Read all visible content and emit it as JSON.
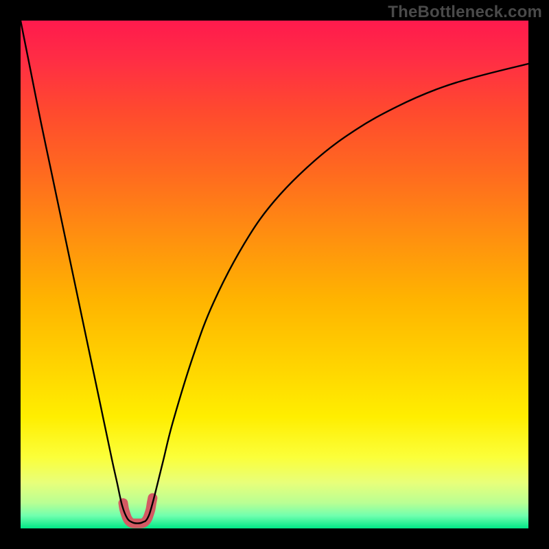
{
  "watermark": "TheBottleneck.com",
  "gradient": {
    "stops": [
      {
        "offset": 0.0,
        "color": "#ff1a4d"
      },
      {
        "offset": 0.08,
        "color": "#ff2e44"
      },
      {
        "offset": 0.18,
        "color": "#ff4a2e"
      },
      {
        "offset": 0.3,
        "color": "#ff6a1f"
      },
      {
        "offset": 0.42,
        "color": "#ff8e10"
      },
      {
        "offset": 0.55,
        "color": "#ffb400"
      },
      {
        "offset": 0.68,
        "color": "#ffd400"
      },
      {
        "offset": 0.78,
        "color": "#ffee00"
      },
      {
        "offset": 0.86,
        "color": "#fbff3a"
      },
      {
        "offset": 0.91,
        "color": "#e8ff7a"
      },
      {
        "offset": 0.95,
        "color": "#b9ff94"
      },
      {
        "offset": 0.975,
        "color": "#70ffae"
      },
      {
        "offset": 1.0,
        "color": "#00e887"
      }
    ]
  },
  "chart_data": {
    "type": "line",
    "title": "",
    "xlabel": "",
    "ylabel": "",
    "xlim": [
      0,
      100
    ],
    "ylim": [
      0,
      100
    ],
    "grid": false,
    "series": [
      {
        "name": "bottleneck-curve",
        "x": [
          0,
          2,
          4,
          6,
          8,
          10,
          12,
          14,
          16,
          18,
          19,
          20,
          21,
          22,
          23,
          24,
          25,
          26,
          28,
          30,
          34,
          38,
          44,
          50,
          58,
          66,
          74,
          82,
          90,
          100
        ],
        "values": [
          100,
          90,
          80,
          70.5,
          61,
          51.5,
          42,
          32.5,
          23,
          13.5,
          9,
          4.5,
          2,
          1.2,
          1.0,
          1.2,
          2,
          5,
          13,
          21,
          34,
          44.5,
          56,
          64.5,
          72.5,
          78.5,
          83,
          86.5,
          89,
          91.5
        ]
      }
    ],
    "highlight": {
      "name": "bottleneck-floor",
      "color": "#d35a63",
      "x": [
        20.2,
        20.4,
        20.7,
        21.0,
        21.4,
        21.8,
        22.2,
        22.6,
        23.0,
        23.4,
        23.8,
        24.2,
        24.6,
        25.0,
        25.3,
        25.6,
        25.8,
        26.0
      ],
      "values": [
        5.0,
        3.8,
        2.8,
        2.0,
        1.4,
        1.1,
        1.0,
        1.0,
        1.0,
        1.0,
        1.0,
        1.1,
        1.4,
        2.0,
        2.8,
        3.8,
        5.0,
        6.0
      ]
    }
  }
}
